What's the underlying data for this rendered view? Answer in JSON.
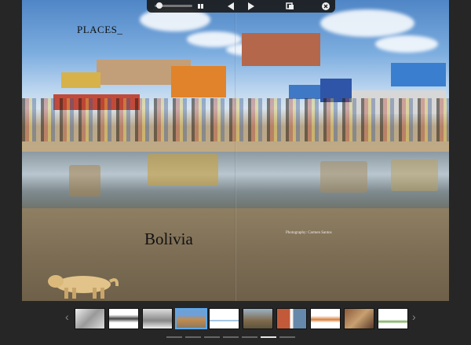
{
  "toolbar": {
    "zoom_slider": "zoom-slider",
    "icons": [
      "slider-knob-icon",
      "grid-view-icon",
      "prev-page-icon",
      "next-page-icon",
      "bookmark-icon",
      "close-icon"
    ]
  },
  "page": {
    "title": "PLACES_",
    "country": "Bolivia",
    "credit": "Photography: Carmen Santos"
  },
  "filmstrip": {
    "prev_icon": "‹",
    "next_icon": "›",
    "thumbnails": 10,
    "active_index": 3
  },
  "pager": {
    "count": 7,
    "active_index": 5
  },
  "colors": {
    "accent": "#5fa8e8",
    "background": "#262626"
  }
}
